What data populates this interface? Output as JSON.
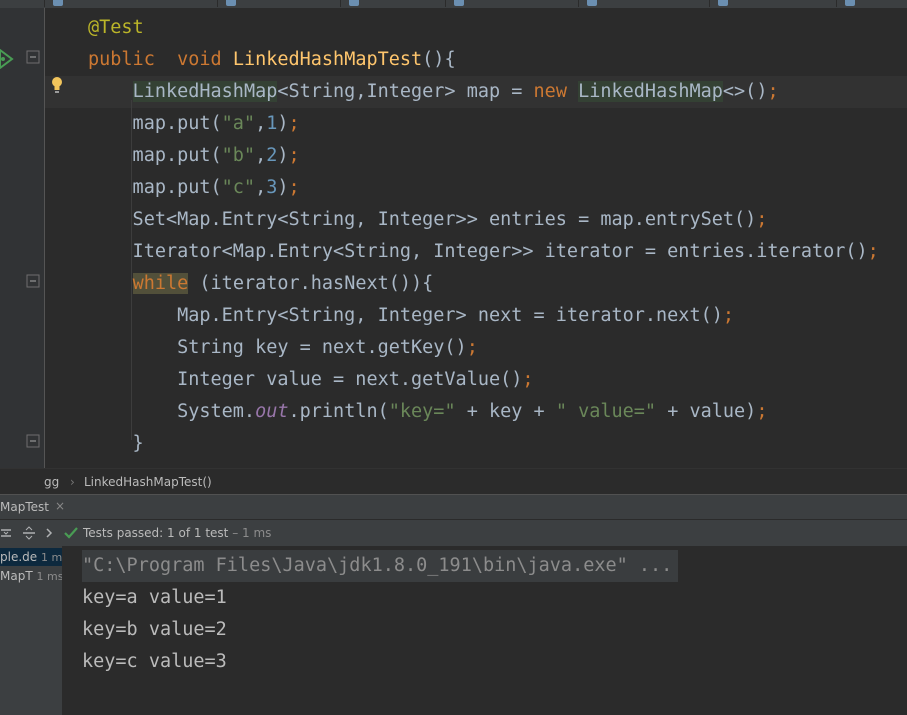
{
  "editor": {
    "lines": [
      [
        {
          "t": "@Test",
          "c": "ann"
        }
      ],
      [
        {
          "t": "public",
          "c": "kw"
        },
        {
          "t": "  "
        },
        {
          "t": "void",
          "c": "kw"
        },
        {
          "t": " "
        },
        {
          "t": "LinkedHashMapTest",
          "c": "fn"
        },
        {
          "t": "(){"
        }
      ],
      [
        {
          "t": "    "
        },
        {
          "t": "LinkedHashMap",
          "c": "hl"
        },
        {
          "t": "<String,Integer> map = "
        },
        {
          "t": "new",
          "c": "kw"
        },
        {
          "t": " "
        },
        {
          "t": "LinkedHashMap",
          "c": "hl"
        },
        {
          "t": "<>()"
        },
        {
          "t": ";",
          "c": "kw"
        }
      ],
      [
        {
          "t": "    map.put("
        },
        {
          "t": "\"a\"",
          "c": "str"
        },
        {
          "t": ","
        },
        {
          "t": "1",
          "c": "num"
        },
        {
          "t": ")"
        },
        {
          "t": ";",
          "c": "kw"
        }
      ],
      [
        {
          "t": "    map.put("
        },
        {
          "t": "\"b\"",
          "c": "str"
        },
        {
          "t": ","
        },
        {
          "t": "2",
          "c": "num"
        },
        {
          "t": ")"
        },
        {
          "t": ";",
          "c": "kw"
        }
      ],
      [
        {
          "t": "    map.put("
        },
        {
          "t": "\"c\"",
          "c": "str"
        },
        {
          "t": ","
        },
        {
          "t": "3",
          "c": "num"
        },
        {
          "t": ")"
        },
        {
          "t": ";",
          "c": "kw"
        }
      ],
      [
        {
          "t": "    Set<Map.Entry<String, Integer>> entries = map.entrySet()"
        },
        {
          "t": ";",
          "c": "kw"
        }
      ],
      [
        {
          "t": "    Iterator<Map.Entry<String, Integer>> iterator = entries.iterator()"
        },
        {
          "t": ";",
          "c": "kw"
        }
      ],
      [
        {
          "t": "    "
        },
        {
          "t": "while",
          "c": "kw hlw"
        },
        {
          "t": " (iterator.hasNext()){"
        }
      ],
      [
        {
          "t": "        Map.Entry<String, Integer> next = iterator.next()"
        },
        {
          "t": ";",
          "c": "kw"
        }
      ],
      [
        {
          "t": "        String key = next.getKey()"
        },
        {
          "t": ";",
          "c": "kw"
        }
      ],
      [
        {
          "t": "        Integer value = next.getValue()"
        },
        {
          "t": ";",
          "c": "kw"
        }
      ],
      [
        {
          "t": "        System."
        },
        {
          "t": "out",
          "c": "fld"
        },
        {
          "t": ".println("
        },
        {
          "t": "\"key=\"",
          "c": "str"
        },
        {
          "t": " + key + "
        },
        {
          "t": "\" value=\"",
          "c": "str"
        },
        {
          "t": " + value)"
        },
        {
          "t": ";",
          "c": "kw"
        }
      ],
      [
        {
          "t": "    }"
        }
      ]
    ]
  },
  "breadcrumb": {
    "item1": "gg",
    "separator": "›",
    "item2": "LinkedHashMapTest()"
  },
  "run_panel": {
    "tab_label": "MapTest",
    "close_label": "×",
    "status_prefix": "Tests passed: ",
    "status_count": "1",
    "status_mid": " of 1 test",
    "status_time": " – 1 ms"
  },
  "test_tree": {
    "rows": [
      {
        "label": "ple.de",
        "time": "1 ms"
      },
      {
        "label": "MapT",
        "time": "1 ms"
      }
    ]
  },
  "console": {
    "command": "\"C:\\Program Files\\Java\\jdk1.8.0_191\\bin\\java.exe\" ...",
    "output": [
      "key=a value=1",
      "key=b value=2",
      "key=c value=3"
    ]
  },
  "colors": {
    "background": "#2b2b2b",
    "keyword": "#cc7832",
    "string": "#6a8759",
    "number": "#6897bb",
    "method": "#ffc66d",
    "annotation": "#bbb529",
    "pass": "#499c54"
  }
}
